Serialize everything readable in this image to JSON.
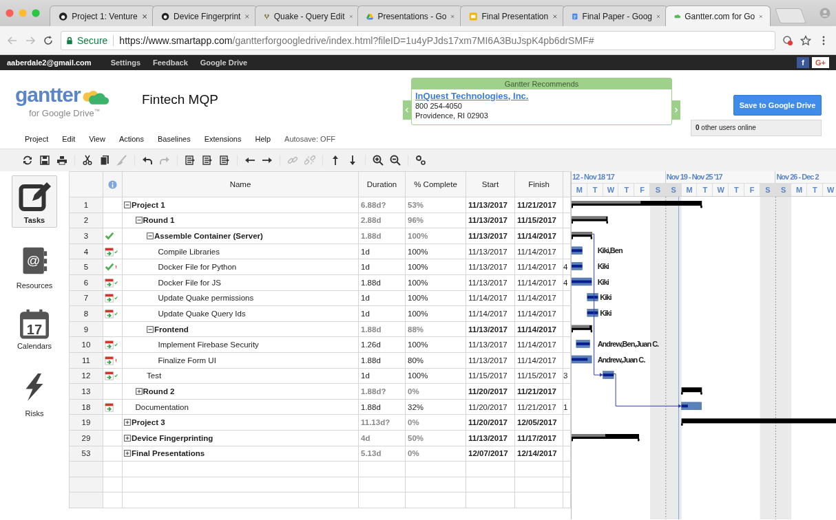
{
  "browser": {
    "tabs": [
      {
        "label": "Project 1: Venture",
        "kind": "github",
        "selected": false
      },
      {
        "label": "Device Fingerprint",
        "kind": "github",
        "selected": false
      },
      {
        "label": "Quake - Query Edit",
        "kind": "quake",
        "selected": false
      },
      {
        "label": "Presentations - Go",
        "kind": "drive",
        "selected": false
      },
      {
        "label": "Final Presentation",
        "kind": "slides",
        "selected": false
      },
      {
        "label": "Final Paper - Goog",
        "kind": "docs",
        "selected": false
      },
      {
        "label": "Gantter.com for Go",
        "kind": "cloud",
        "selected": true
      }
    ],
    "secure": "Secure",
    "url_host": "https://www.smartapp.com",
    "url_path": "/gantterforgoogledrive/index.html?fileID=1u4yPJds17xm7MI6A3BuJspK4pb6drSMF#"
  },
  "topbar": {
    "account": "aaberdale2@gmail.com",
    "links": [
      "Settings",
      "Feedback",
      "Google Drive"
    ],
    "social": [
      {
        "kind": "facebook",
        "label": "f"
      },
      {
        "kind": "googleplus",
        "label": "G+"
      }
    ]
  },
  "header": {
    "logo": "gantter",
    "logo_sub": "for Google Drive",
    "logo_tm": "™",
    "project_title": "Fintech MQP",
    "recommend": {
      "title": "Gantter Recommends",
      "company": "InQuest Technologies, Inc.",
      "phone": "800 254-4050",
      "address": "Providence, RI 02903"
    },
    "save_button": "Save to Google Drive",
    "users_online": "**0** other users online"
  },
  "menu": {
    "items": [
      "Project",
      "Edit",
      "View",
      "Actions",
      "Baselines",
      "Extensions",
      "Help"
    ],
    "autosave": "Autosave: OFF"
  },
  "toolbar": [
    [
      {
        "kind": "refresh",
        "disabled": false
      },
      {
        "kind": "save",
        "disabled": false
      },
      {
        "kind": "print",
        "disabled": false
      }
    ],
    [
      {
        "kind": "cut",
        "disabled": false
      },
      {
        "kind": "copy",
        "disabled": false
      },
      {
        "kind": "paint",
        "disabled": true
      }
    ],
    [
      {
        "kind": "undo",
        "disabled": false
      },
      {
        "kind": "redo",
        "disabled": true
      }
    ],
    [
      {
        "kind": "outline",
        "disabled": false
      },
      {
        "kind": "outline",
        "disabled": false
      },
      {
        "kind": "outline",
        "disabled": false
      }
    ],
    [
      {
        "kind": "left",
        "disabled": false
      },
      {
        "kind": "right",
        "disabled": false
      }
    ],
    [
      {
        "kind": "link",
        "disabled": true
      },
      {
        "kind": "unlink",
        "disabled": true
      }
    ],
    [
      {
        "kind": "up",
        "disabled": false
      },
      {
        "kind": "down",
        "disabled": false
      }
    ],
    [
      {
        "kind": "zoomin",
        "disabled": false
      },
      {
        "kind": "zoomout",
        "disabled": false
      }
    ],
    [
      {
        "kind": "settings",
        "disabled": false
      }
    ]
  ],
  "sidebar": [
    {
      "label": "Tasks",
      "kind": "tasks",
      "selected": true
    },
    {
      "label": "Resources",
      "kind": "resources",
      "icon_text": "@",
      "selected": false
    },
    {
      "label": "Calendars",
      "kind": "calendars",
      "icon_text": "17",
      "selected": false
    },
    {
      "label": "Risks",
      "kind": "risks",
      "selected": false
    }
  ],
  "table": {
    "columns": [
      "Name",
      "Duration",
      "% Complete",
      "Start",
      "Finish"
    ],
    "rows": [
      {
        "id": "1",
        "name": "Project 1",
        "duration": "6.88d?",
        "percent": "53%",
        "start": "11/13/2017",
        "finish": "11/21/2017",
        "expanded": true,
        "children": [
          {
            "id": "2",
            "name": "Round 1",
            "duration": "2.88d",
            "percent": "96%",
            "start": "11/13/2017",
            "finish": "11/15/2017",
            "expanded": true,
            "children": [
              {
                "id": "3",
                "name": "Assemble Container (Server)",
                "duration": "1.88d",
                "percent": "100%",
                "start": "11/13/2017",
                "finish": "11/14/2017",
                "indicators": [
                  {
                    "kind": "complete"
                  }
                ],
                "expanded": true,
                "children": [
                  {
                    "id": "4",
                    "name": "Compile Libraries",
                    "duration": "1d",
                    "percent": "100%",
                    "start": "11/13/2017",
                    "finish": "11/14/2017",
                    "indicators": [
                      {
                        "kind": "calendar"
                      },
                      {
                        "kind": "ontime"
                      }
                    ],
                    "resources": "Kiki,Ben"
                  },
                  {
                    "id": "5",
                    "name": "Docker File for Python",
                    "duration": "1d",
                    "percent": "100%",
                    "start": "11/13/2017",
                    "finish": "11/14/2017",
                    "indicators": [
                      {
                        "kind": "complete"
                      },
                      {
                        "kind": "late"
                      }
                    ],
                    "column_8": "4",
                    "resources": "Kiki"
                  },
                  {
                    "id": "6",
                    "name": "Docker File for JS",
                    "duration": "1.88d",
                    "percent": "100%",
                    "start": "11/13/2017",
                    "finish": "11/14/2017",
                    "indicators": [
                      {
                        "kind": "calendar"
                      },
                      {
                        "kind": "ontime"
                      }
                    ],
                    "column_8": "4",
                    "resources": "Kiki"
                  },
                  {
                    "id": "7",
                    "name": "Update Quake permissions",
                    "duration": "1d",
                    "percent": "100%",
                    "start": "11/14/2017",
                    "finish": "11/14/2017",
                    "indicators": [
                      {
                        "kind": "calendar"
                      },
                      {
                        "kind": "ontime"
                      }
                    ],
                    "resources": "Kiki"
                  },
                  {
                    "id": "8",
                    "name": "Update Quake Query Ids",
                    "duration": "1d",
                    "percent": "100%",
                    "start": "11/14/2017",
                    "finish": "11/14/2017",
                    "indicators": [
                      {
                        "kind": "calendar"
                      },
                      {
                        "kind": "ontime"
                      }
                    ],
                    "resources": "Kiki"
                  }
                ]
              },
              {
                "id": "9",
                "name": "Frontend",
                "duration": "1.88d",
                "percent": "88%",
                "start": "11/13/2017",
                "finish": "11/14/2017",
                "expanded": true,
                "children": [
                  {
                    "id": "10",
                    "name": "Implement Firebase Security",
                    "duration": "1.26d",
                    "percent": "100%",
                    "start": "11/13/2017",
                    "finish": "11/14/2017",
                    "indicators": [
                      {
                        "kind": "calendar"
                      },
                      {
                        "kind": "ontime"
                      }
                    ],
                    "resources": "Andrew,Ben,Juan C."
                  },
                  {
                    "id": "11",
                    "name": "Finalize Form UI",
                    "duration": "1.88d",
                    "percent": "80%",
                    "start": "11/13/2017",
                    "finish": "11/14/2017",
                    "indicators": [
                      {
                        "kind": "calendar"
                      },
                      {
                        "kind": "late"
                      }
                    ],
                    "resources": "Andrew,Juan C."
                  }
                ]
              },
              {
                "id": "12",
                "name": "Test",
                "duration": "1d",
                "percent": "100%",
                "start": "11/15/2017",
                "finish": "11/15/2017",
                "indicators": [
                  {
                    "kind": "calendar"
                  },
                  {
                    "kind": "ontime"
                  }
                ],
                "column_8": "3"
              }
            ]
          },
          {
            "id": "13",
            "name": "Round 2",
            "duration": "1.88d?",
            "percent": "0%",
            "start": "11/20/2017",
            "finish": "11/21/2017",
            "expanded": false
          },
          {
            "id": "18",
            "name": "Documentation",
            "duration": "1.88d",
            "percent": "32%",
            "start": "11/20/2017",
            "finish": "11/21/2017",
            "indicators": [
              {
                "kind": "calendar"
              }
            ],
            "column_8": "1"
          }
        ]
      },
      {
        "id": "19",
        "name": "Project 3",
        "duration": "11.13d?",
        "percent": "0%",
        "start": "11/20/2017",
        "finish": "12/05/2017",
        "expanded": false
      },
      {
        "id": "29",
        "name": "Device Fingerprinting",
        "duration": "4d",
        "percent": "50%",
        "start": "11/13/2017",
        "finish": "11/17/2017",
        "expanded": false
      },
      {
        "id": "53",
        "name": "Final Presentations",
        "duration": "5.13d",
        "percent": "0%",
        "start": "12/07/2017",
        "finish": "12/14/2017",
        "expanded": false
      }
    ]
  },
  "gantt": {
    "weeks": [
      "12 - Nov 18 '17",
      "Nov 19 - Nov 25 '17",
      "Nov 26 - Dec 2"
    ],
    "days": [
      {
        "label": "M",
        "weekend": false
      },
      {
        "label": "T",
        "weekend": false
      },
      {
        "label": "W",
        "weekend": false
      },
      {
        "label": "T",
        "weekend": false
      },
      {
        "label": "F",
        "weekend": false
      },
      {
        "label": "S",
        "weekend": true
      },
      {
        "label": "S",
        "weekend": true
      },
      {
        "label": "M",
        "weekend": false
      },
      {
        "label": "T",
        "weekend": false
      },
      {
        "label": "W",
        "weekend": false
      },
      {
        "label": "T",
        "weekend": false
      },
      {
        "label": "F",
        "weekend": false
      },
      {
        "label": "S",
        "weekend": true
      },
      {
        "label": "S",
        "weekend": true
      },
      {
        "label": "M",
        "weekend": false
      },
      {
        "label": "T",
        "weekend": false
      },
      {
        "label": "W",
        "weekend": false
      }
    ]
  }
}
